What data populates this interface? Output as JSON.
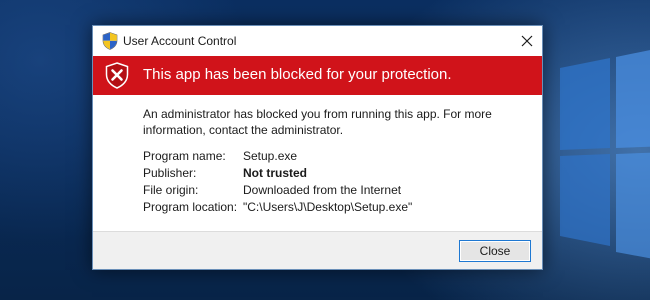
{
  "dialog": {
    "title": "User Account Control",
    "banner_text": "This app has been blocked for your protection.",
    "message": "An administrator has blocked you from running this app. For more information, contact the administrator.",
    "details": [
      {
        "label": "Program name:",
        "value": "Setup.exe"
      },
      {
        "label": "Publisher:",
        "value": "Not trusted"
      },
      {
        "label": "File origin:",
        "value": "Downloaded from the Internet"
      },
      {
        "label": "Program location:",
        "value": "\"C:\\Users\\J\\Desktop\\Setup.exe\""
      }
    ],
    "close_button_label": "Close",
    "icons": {
      "title_icon": "uac-shield-icon",
      "banner_icon": "blocked-shield-icon",
      "close_icon": "close-icon"
    },
    "colors": {
      "banner": "#d0131a",
      "button_border": "#1e78d2",
      "footer": "#f0f0f0"
    }
  },
  "desktop": {
    "wallpaper_icon": "windows-logo-icon"
  }
}
